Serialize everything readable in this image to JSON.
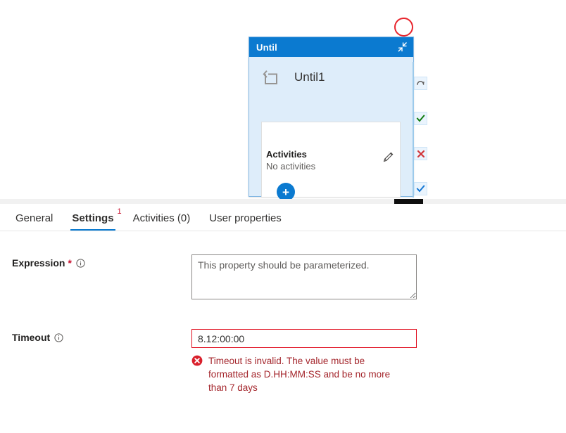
{
  "canvas": {
    "activity_panel": {
      "header_title": "Until",
      "collapse_icon": "collapse-diagonal-arrows-icon",
      "node_icon": "loop-until-icon",
      "node_label": "Until1",
      "activities_title": "Activities",
      "activities_subtitle": "No activities",
      "edit_icon": "pencil-icon",
      "add_button_label": "+",
      "add_button_icon": "plus-icon"
    },
    "annotation": {
      "shape": "circle",
      "color": "#e8262e"
    },
    "status_rail": [
      {
        "name": "retry-icon",
        "glyph": "retry",
        "color": "#605e5c"
      },
      {
        "name": "success-icon",
        "glyph": "check",
        "color": "#107c10"
      },
      {
        "name": "failure-icon",
        "glyph": "cross",
        "color": "#d13438"
      },
      {
        "name": "completion-icon",
        "glyph": "check",
        "color": "#0b7ad0"
      }
    ]
  },
  "properties": {
    "tabs": [
      {
        "label": "General",
        "selected": false,
        "badge": ""
      },
      {
        "label": "Settings",
        "selected": true,
        "badge": "1"
      },
      {
        "label": "Activities (0)",
        "selected": false,
        "badge": ""
      },
      {
        "label": "User properties",
        "selected": false,
        "badge": ""
      }
    ],
    "fields": {
      "expression": {
        "label": "Expression",
        "required_marker": "*",
        "info_icon": "info-icon",
        "value": "",
        "placeholder": "This property should be parameterized."
      },
      "timeout": {
        "label": "Timeout",
        "info_icon": "info-icon",
        "value": "8.12:00:00",
        "error_icon": "error-circle-x-icon",
        "error_message": "Timeout is invalid. The value must be formatted as D.HH:MM:SS and be no more than 7 days"
      }
    }
  },
  "colors": {
    "accent": "#0b7ad0",
    "panel_body": "#deedfa",
    "error": "#a4262c",
    "error_border": "#e00b1c",
    "badge": "#c8102e",
    "success": "#107c10"
  }
}
